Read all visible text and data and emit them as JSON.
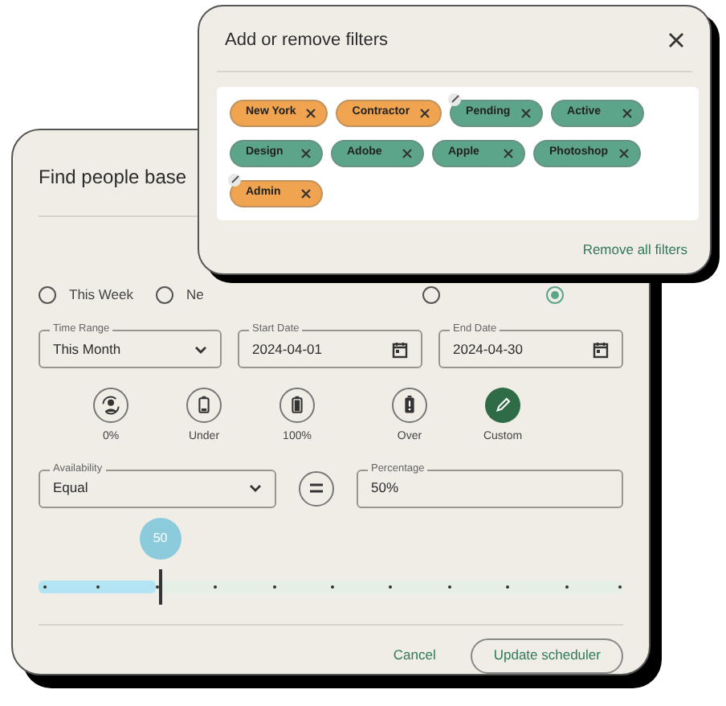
{
  "main_dialog": {
    "title": "Find people base",
    "radios": [
      {
        "label": "This Week",
        "selected": false
      },
      {
        "label": "Ne",
        "selected": false
      },
      {
        "selected": false
      },
      {
        "selected": true
      }
    ],
    "fields": [
      {
        "kind": "select",
        "label": "Time Range",
        "value": "This Month"
      },
      {
        "kind": "date",
        "label": "Start Date",
        "value": "2024-04-01"
      },
      {
        "kind": "date",
        "label": "End Date",
        "value": "2024-04-30"
      }
    ],
    "levels": [
      {
        "kind": "zero",
        "label": "0%",
        "selected": false
      },
      {
        "kind": "under",
        "label": "Under",
        "selected": false
      },
      {
        "kind": "full",
        "label": "100%",
        "selected": false
      },
      {
        "kind": "over",
        "label": "Over",
        "selected": false
      },
      {
        "kind": "custom",
        "label": "Custom",
        "selected": true
      }
    ],
    "availability": {
      "label": "Availability",
      "value": "Equal"
    },
    "percentage": {
      "label": "Percentage",
      "value": "50%"
    },
    "slider": {
      "level": 0.2,
      "reading": "50"
    },
    "buttons": [
      {
        "label": "Cancel",
        "kind": "text"
      },
      {
        "label": "Update scheduler",
        "kind": "outlined"
      }
    ]
  },
  "filters_dialog": {
    "title": "Add or remove filters",
    "chips": [
      {
        "label": "New York",
        "color": "#f0a44f",
        "marked": false
      },
      {
        "label": "Contractor",
        "color": "#f0a44f",
        "marked": false
      },
      {
        "label": "Pending",
        "color": "#5da58a",
        "marked": true
      },
      {
        "label": "Active",
        "color": "#5da58a",
        "marked": false
      },
      {
        "label": "Design",
        "color": "#5da58a",
        "marked": false
      },
      {
        "label": "Adobe",
        "color": "#5da58a",
        "marked": false
      },
      {
        "label": "Apple",
        "color": "#5da58a",
        "marked": false
      },
      {
        "label": "Photoshop",
        "color": "#5da58a",
        "marked": false
      },
      {
        "label": "Admin",
        "color": "#f0a44f",
        "marked": true
      }
    ],
    "remove_all": "Remove all filters"
  }
}
